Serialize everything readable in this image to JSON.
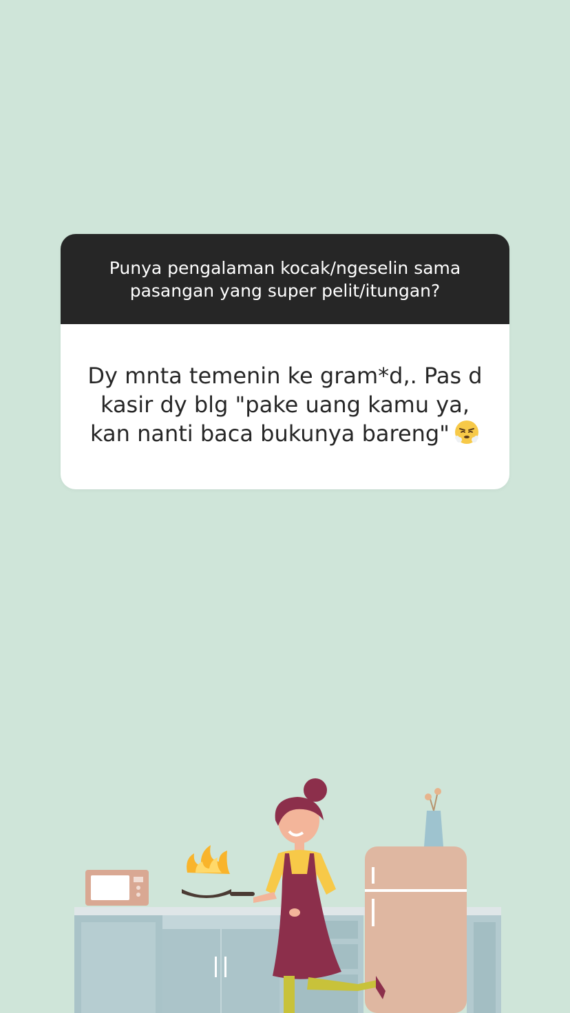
{
  "story": {
    "question": "Punya pengalaman kocak/ngeselin sama pasangan yang super pelit/itungan?",
    "answer": "Dy mnta temenin ke gram*d,. Pas d kasir dy blg \"pake uang kamu ya, kan nanti baca bukunya bareng\"",
    "answer_emoji": "face-with-steam-icon"
  },
  "colors": {
    "background": "#cfe5d9",
    "question_bg": "#262626",
    "answer_bg": "#ffffff"
  },
  "illustration": {
    "subject": "woman-cooking-in-kitchen",
    "items": [
      "microwave-icon",
      "frying-pan-with-fire-icon",
      "refrigerator-icon",
      "flower-vase-icon",
      "kitchen-cabinets"
    ]
  }
}
